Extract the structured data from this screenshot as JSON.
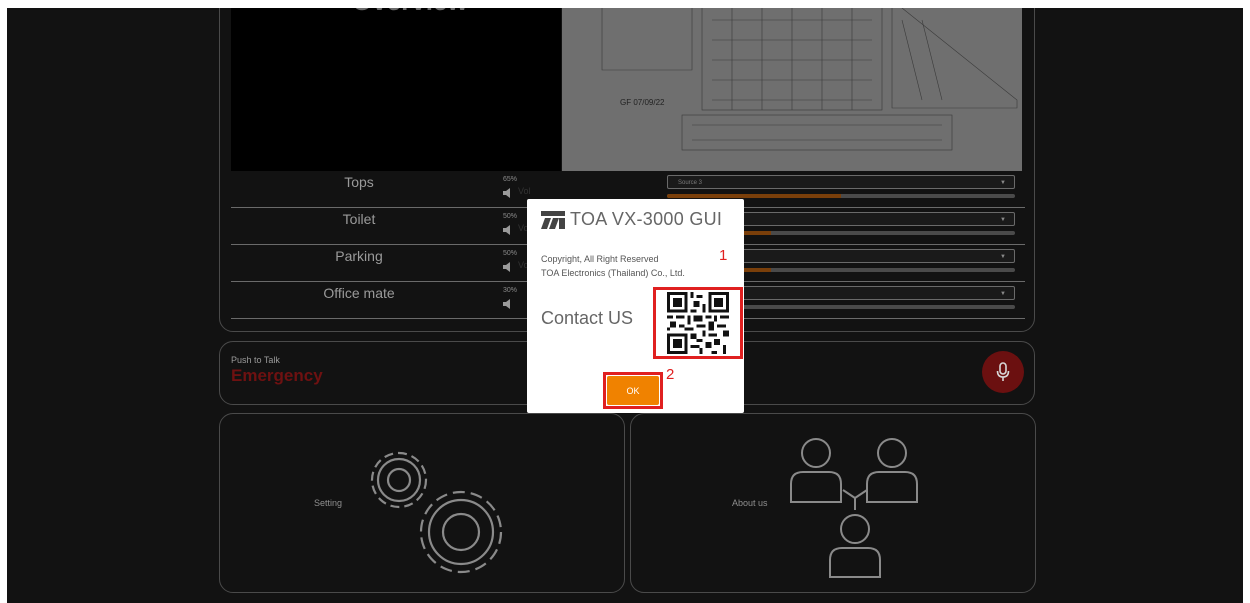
{
  "overview": {
    "title": "Overview",
    "map_label": "GF 07/09/22"
  },
  "zones": [
    {
      "name": "Tops",
      "volume": "65%",
      "vol_label": "Vol",
      "source": "Source 3",
      "level": 0.5
    },
    {
      "name": "Toilet",
      "volume": "50%",
      "vol_label": "Vo",
      "source": "",
      "level": 0.3
    },
    {
      "name": "Parking",
      "volume": "50%",
      "vol_label": "Vo",
      "source": "",
      "level": 0.3
    },
    {
      "name": "Office mate",
      "volume": "30%",
      "vol_label": "",
      "source": "",
      "level": 0.18
    }
  ],
  "push_to_talk": {
    "label": "Push to Talk",
    "mode": "Emergency"
  },
  "cards": {
    "setting": "Setting",
    "about": "About us"
  },
  "modal": {
    "title": "TOA VX-3000 GUI",
    "copyright_line1": "Copyright, All Right Reserved",
    "copyright_line2": "TOA Electronics (Thailand) Co., Ltd.",
    "contact": "Contact US",
    "ok": "OK",
    "annotation_1": "1",
    "annotation_2": "2"
  },
  "colors": {
    "accent": "#f08200",
    "emergency": "#6e1111",
    "annotation": "#e02020",
    "background": "#121212"
  },
  "icons": [
    "speaker-icon",
    "mic-icon",
    "gears-icon",
    "people-icon",
    "toa-logo-icon",
    "qr-code-icon",
    "chevron-down-icon"
  ]
}
